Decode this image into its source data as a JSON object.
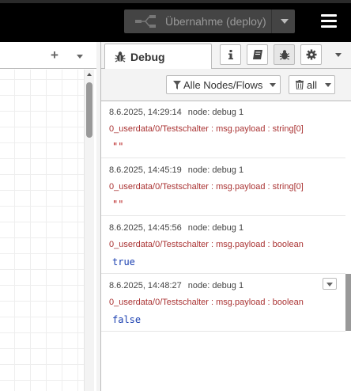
{
  "header": {
    "deploy_label": "Übernahme (deploy)",
    "deploy_icon": "deploy-flow-icon",
    "menu_icon": "hamburger-menu-icon",
    "background": "#000000"
  },
  "workspace": {
    "add_tab_label": "+",
    "tab_menu_icon": "chevron-down-icon"
  },
  "sidebar": {
    "active_tab": {
      "label": "Debug",
      "icon": "bug-icon"
    },
    "tab_buttons": [
      {
        "name": "info",
        "icon": "info-icon"
      },
      {
        "name": "help",
        "icon": "book-icon"
      },
      {
        "name": "debug",
        "icon": "bug-icon",
        "active": true
      },
      {
        "name": "config",
        "icon": "gear-icon"
      }
    ],
    "filter": {
      "nodes_label": "Alle Nodes/Flows",
      "clear_label": "all"
    },
    "messages": [
      {
        "timestamp": "8.6.2025, 14:29:14",
        "node": "node: debug 1",
        "topic": "0_userdata/0/Testschalter : msg.payload : string[0]",
        "payload": "\"\"",
        "payload_type": "string"
      },
      {
        "timestamp": "8.6.2025, 14:45:19",
        "node": "node: debug 1",
        "topic": "0_userdata/0/Testschalter : msg.payload : string[0]",
        "payload": "\"\"",
        "payload_type": "string"
      },
      {
        "timestamp": "8.6.2025, 14:45:56",
        "node": "node: debug 1",
        "topic": "0_userdata/0/Testschalter : msg.payload : boolean",
        "payload": "true",
        "payload_type": "boolean"
      },
      {
        "timestamp": "8.6.2025, 14:48:27",
        "node": "node: debug 1",
        "topic": "0_userdata/0/Testschalter : msg.payload : boolean",
        "payload": "false",
        "payload_type": "boolean"
      }
    ]
  },
  "colors": {
    "string_payload": "#b71c1c",
    "boolean_payload": "#1a3fb0",
    "topic": "#aa3333"
  }
}
